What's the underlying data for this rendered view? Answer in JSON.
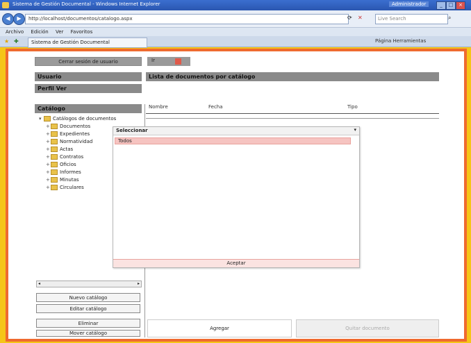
{
  "window": {
    "title": "Sistema de Gestión Documental - Windows Internet Explorer",
    "user": "Administrador",
    "url": "http://localhost/documentos/catalogo.aspx"
  },
  "browser": {
    "search_placeholder": "Live Search",
    "menu": [
      "Archivo",
      "Edición",
      "Ver",
      "Favoritos"
    ],
    "tab_label": "Sistema de Gestión Documental",
    "command_bar": "Página  Herramientas"
  },
  "app": {
    "top_button": "Cerrar sesión de usuario",
    "top_tool": "Ir",
    "user_label": "Usuario",
    "role_label": "Perfil Ver",
    "catalog_header": "Catálogo",
    "list_header": "Lista de documentos por catálogo",
    "tree": [
      {
        "label": "Catálogos de documentos",
        "root": true
      },
      {
        "label": "Documentos"
      },
      {
        "label": "Expedientes"
      },
      {
        "label": "Normatividad"
      },
      {
        "label": "Actas"
      },
      {
        "label": "Contratos"
      },
      {
        "label": "Oficios"
      },
      {
        "label": "Informes"
      },
      {
        "label": "Minutas"
      },
      {
        "label": "Circulares"
      }
    ],
    "columns": [
      "Nombre",
      "Fecha",
      "Tipo"
    ],
    "sidebar_buttons": [
      "Nuevo catálogo",
      "Editar catálogo",
      "Eliminar",
      "Mover catálogo"
    ],
    "bottom_buttons": {
      "left": "Agregar",
      "right": "Quitar documento"
    }
  },
  "dropdown": {
    "title": "Seleccionar",
    "items": [
      "Todos"
    ],
    "ok_label": "Aceptar"
  }
}
